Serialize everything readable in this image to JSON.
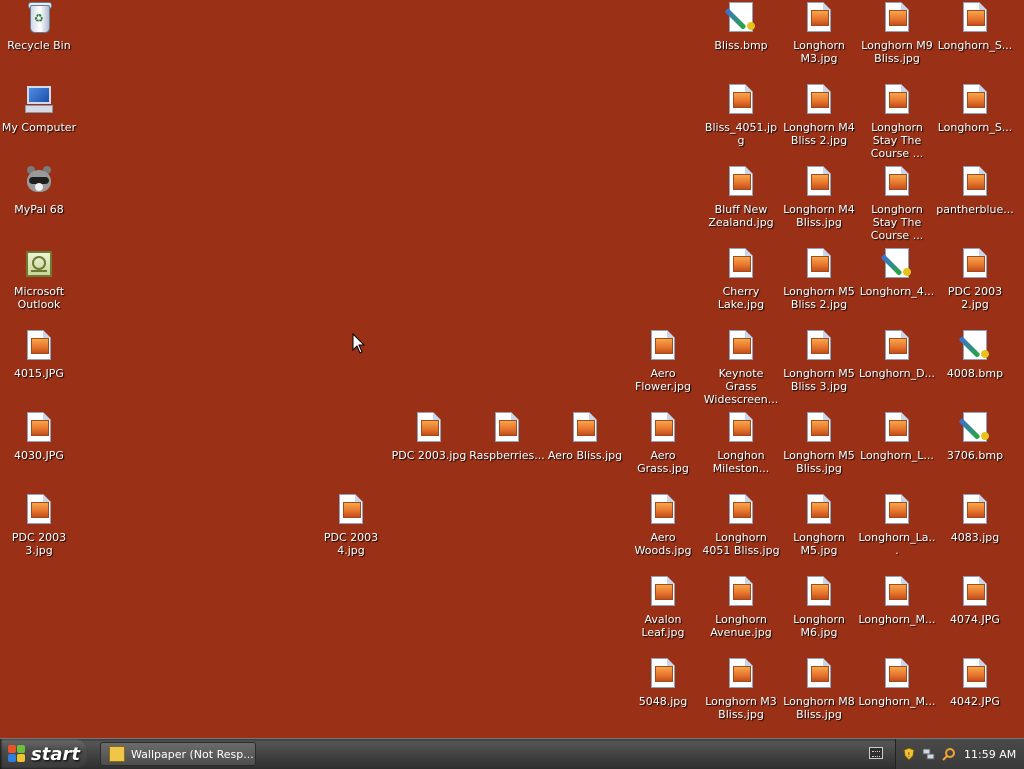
{
  "desktop": {
    "background": "#9a3117",
    "icons": [
      {
        "name": "recycle-bin-icon",
        "label": "Recycle Bin"
      },
      {
        "name": "my-computer-icon",
        "label": "My Computer"
      },
      {
        "name": "mypal-icon",
        "label": "MyPal 68"
      },
      {
        "name": "outlook-icon",
        "label": "Microsoft Outlook"
      },
      {
        "name": "file-4015",
        "label": "4015.JPG"
      },
      {
        "name": "file-4030",
        "label": "4030.JPG"
      },
      {
        "name": "file-pdc2003-3",
        "label": "PDC 2003 3.jpg"
      },
      {
        "name": "file-pdc2003-4",
        "label": "PDC 2003 4.jpg"
      },
      {
        "name": "file-pdc2003",
        "label": "PDC 2003.jpg"
      },
      {
        "name": "file-raspberries",
        "label": "Raspberries..."
      },
      {
        "name": "file-aero-bliss",
        "label": "Aero Bliss.jpg"
      },
      {
        "name": "file-aero-grass",
        "label": "Aero Grass.jpg"
      },
      {
        "name": "file-aero-flower",
        "label": "Aero Flower.jpg"
      },
      {
        "name": "file-aero-woods",
        "label": "Aero Woods.jpg"
      },
      {
        "name": "file-avalon-leaf",
        "label": "Avalon Leaf.jpg"
      },
      {
        "name": "file-5048",
        "label": "5048.jpg"
      },
      {
        "name": "file-bliss-bmp",
        "label": "Bliss.bmp"
      },
      {
        "name": "file-bliss-4051",
        "label": "Bliss_4051.jpg"
      },
      {
        "name": "file-bluff-nz",
        "label": "Bluff New Zealand.jpg"
      },
      {
        "name": "file-cherry-lake",
        "label": "Cherry Lake.jpg"
      },
      {
        "name": "file-keynote-grass",
        "label": "Keynote Grass Widescreen..."
      },
      {
        "name": "file-longhorn-milestone",
        "label": "Longhon Mileston..."
      },
      {
        "name": "file-longhorn-4051-bliss",
        "label": "Longhorn 4051 Bliss.jpg"
      },
      {
        "name": "file-longhorn-avenue",
        "label": "Longhorn Avenue.jpg"
      },
      {
        "name": "file-longhorn-m3-bliss",
        "label": "Longhorn M3 Bliss.jpg"
      },
      {
        "name": "file-longhorn-m3",
        "label": "Longhorn M3.jpg"
      },
      {
        "name": "file-longhorn-m4-bliss2",
        "label": "Longhorn M4 Bliss 2.jpg"
      },
      {
        "name": "file-longhorn-m4-bliss",
        "label": "Longhorn M4 Bliss.jpg"
      },
      {
        "name": "file-longhorn-m5-bliss2",
        "label": "Longhorn M5 Bliss 2.jpg"
      },
      {
        "name": "file-longhorn-m5-bliss3",
        "label": "Longhorn M5 Bliss 3.jpg"
      },
      {
        "name": "file-longhorn-m5-bliss",
        "label": "Longhorn M5 Bliss.jpg"
      },
      {
        "name": "file-longhorn-m5",
        "label": "Longhorn M5.jpg"
      },
      {
        "name": "file-longhorn-m6",
        "label": "Longhorn M6.jpg"
      },
      {
        "name": "file-longhorn-m8-bliss",
        "label": "Longhorn M8 Bliss.jpg"
      },
      {
        "name": "file-longhorn-m9-bliss",
        "label": "Longhorn M9 Bliss.jpg"
      },
      {
        "name": "file-longhorn-stay-1",
        "label": "Longhorn Stay The Course ..."
      },
      {
        "name": "file-longhorn-stay-2",
        "label": "Longhorn Stay The Course ..."
      },
      {
        "name": "file-longhorn-4",
        "label": "Longhorn_4..."
      },
      {
        "name": "file-longhorn-d",
        "label": "Longhorn_D..."
      },
      {
        "name": "file-longhorn-l",
        "label": "Longhorn_L..."
      },
      {
        "name": "file-longhorn-la",
        "label": "Longhorn_La..."
      },
      {
        "name": "file-longhorn-m-1",
        "label": "Longhorn_M..."
      },
      {
        "name": "file-longhorn-m-2",
        "label": "Longhorn_M..."
      },
      {
        "name": "file-longhorn-s-1",
        "label": "Longhorn_S..."
      },
      {
        "name": "file-longhorn-s-2",
        "label": "Longhorn_S..."
      },
      {
        "name": "file-pantherblue",
        "label": "pantherblue..."
      },
      {
        "name": "file-pdc2003-2",
        "label": "PDC 2003 2.jpg"
      },
      {
        "name": "file-4008",
        "label": "4008.bmp"
      },
      {
        "name": "file-3706",
        "label": "3706.bmp"
      },
      {
        "name": "file-4083",
        "label": "4083.jpg"
      },
      {
        "name": "file-4074",
        "label": "4074.JPG"
      },
      {
        "name": "file-4042",
        "label": "4042.JPG"
      }
    ]
  },
  "taskbar": {
    "start_label": "start",
    "tasks": [
      {
        "label": "Wallpaper (Not Resp..."
      }
    ],
    "clock": "11:59 AM"
  }
}
